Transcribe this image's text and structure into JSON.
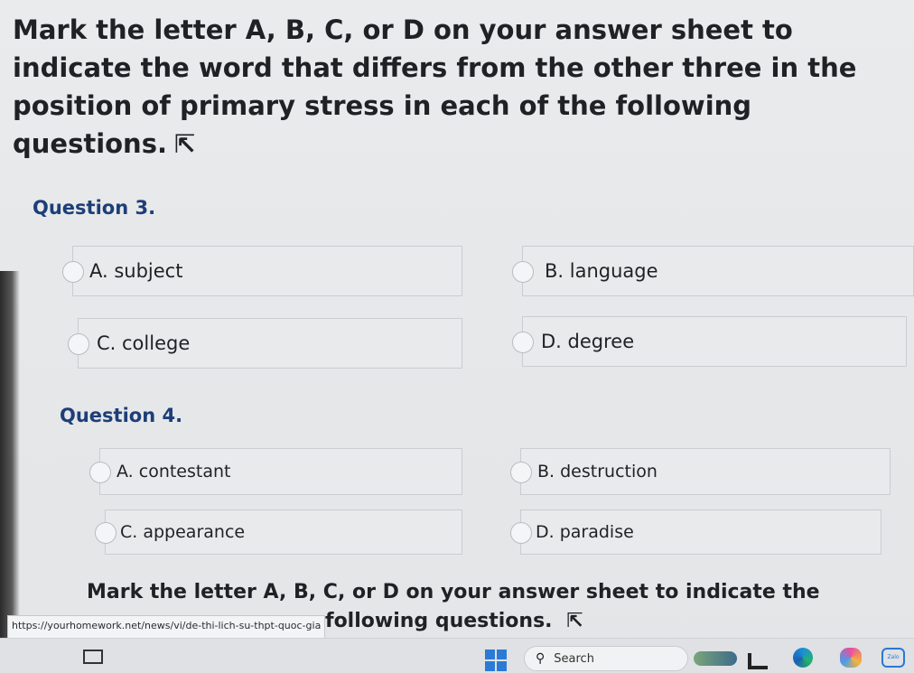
{
  "instruction": {
    "text": "Mark the letter A, B, C, or D on your answer sheet to indicate the word that differs from the other three in the position of primary stress in each of the following questions.",
    "icon": "collapse-arrow-icon"
  },
  "questions": [
    {
      "title": "Question 3.",
      "options": [
        {
          "label": "A. subject"
        },
        {
          "label": "B. language"
        },
        {
          "label": "C. college"
        },
        {
          "label": "D. degree"
        }
      ]
    },
    {
      "title": "Question 4.",
      "options": [
        {
          "label": "A. contestant"
        },
        {
          "label": "B. destruction"
        },
        {
          "label": "C. appearance"
        },
        {
          "label": "D. paradise"
        }
      ]
    }
  ],
  "next_section": {
    "line1": "Mark the letter A, B, C, or D on your answer sheet to indicate the",
    "line2_visible": "following questions."
  },
  "status_url": "https://yourhomework.net/news/vi/de-thi-lich-su-thpt-quoc-gia",
  "taskbar": {
    "search_label": "Search",
    "zalo_label": "Zalo"
  },
  "colors": {
    "question_title": "#1d3e78",
    "option_bg": "#e8eaec",
    "windows_blue": "#2b7ad6"
  }
}
